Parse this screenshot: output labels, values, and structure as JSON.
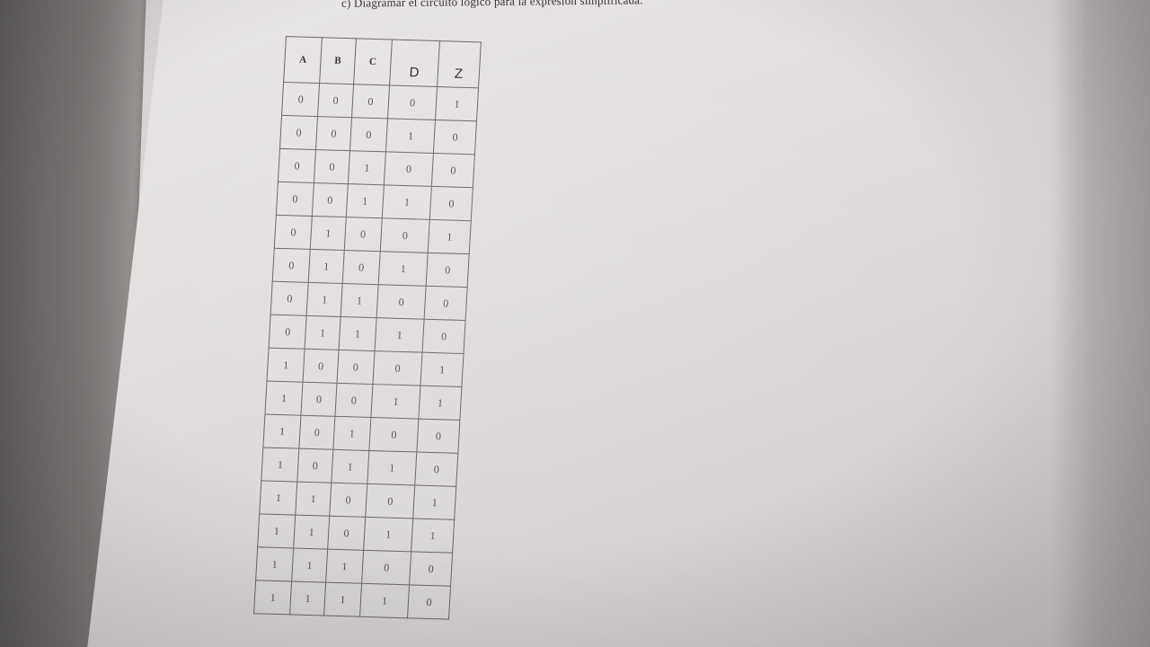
{
  "heading": "c)   Diagramar el circuito lógico para la expresión simplificada.",
  "table": {
    "headers": [
      "A",
      "B",
      "C",
      "D",
      "Z"
    ],
    "rows": [
      [
        "0",
        "0",
        "0",
        "0",
        "1"
      ],
      [
        "0",
        "0",
        "0",
        "1",
        "0"
      ],
      [
        "0",
        "0",
        "1",
        "0",
        "0"
      ],
      [
        "0",
        "0",
        "1",
        "1",
        "0"
      ],
      [
        "0",
        "1",
        "0",
        "0",
        "1"
      ],
      [
        "0",
        "1",
        "0",
        "1",
        "0"
      ],
      [
        "0",
        "1",
        "1",
        "0",
        "0"
      ],
      [
        "0",
        "1",
        "1",
        "1",
        "0"
      ],
      [
        "1",
        "0",
        "0",
        "0",
        "1"
      ],
      [
        "1",
        "0",
        "0",
        "1",
        "1"
      ],
      [
        "1",
        "0",
        "1",
        "0",
        "0"
      ],
      [
        "1",
        "0",
        "1",
        "1",
        "0"
      ],
      [
        "1",
        "1",
        "0",
        "0",
        "1"
      ],
      [
        "1",
        "1",
        "0",
        "1",
        "1"
      ],
      [
        "1",
        "1",
        "1",
        "0",
        "0"
      ],
      [
        "1",
        "1",
        "1",
        "1",
        "0"
      ]
    ]
  }
}
